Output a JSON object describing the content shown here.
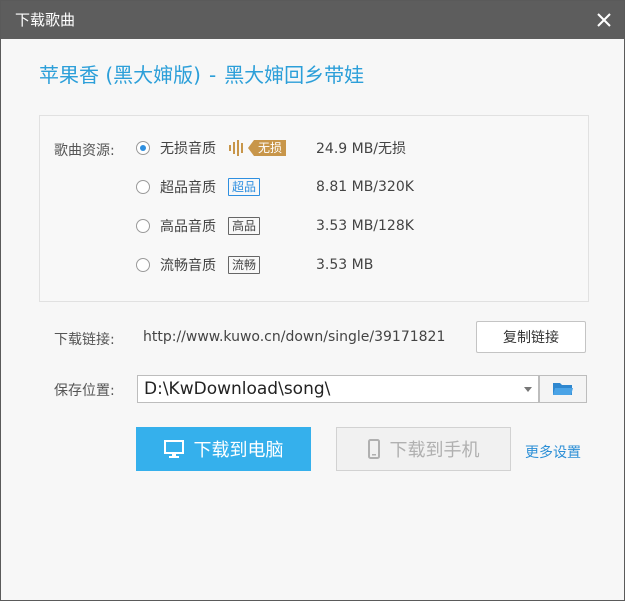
{
  "window": {
    "title": "下载歌曲"
  },
  "song": {
    "name": "苹果香 (黑大婶版)",
    "separator": "-",
    "artist": "黑大婶回乡带娃"
  },
  "source": {
    "label": "歌曲资源:",
    "options": [
      {
        "label": "无损音质",
        "badge": "无损",
        "size": "24.9 MB/无损",
        "selected": true
      },
      {
        "label": "超品音质",
        "badge": "超品",
        "size": "8.81 MB/320K",
        "selected": false
      },
      {
        "label": "高品音质",
        "badge": "高品",
        "size": "3.53 MB/128K",
        "selected": false
      },
      {
        "label": "流畅音质",
        "badge": "流畅",
        "size": "3.53 MB",
        "selected": false
      }
    ]
  },
  "link": {
    "label": "下载链接:",
    "url": "http://www.kuwo.cn/down/single/39171821",
    "copy_label": "复制链接"
  },
  "save": {
    "label": "保存位置:",
    "path": "D:\\KwDownload\\song\\"
  },
  "actions": {
    "pc_label": "下载到电脑",
    "phone_label": "下载到手机",
    "more_label": "更多设置"
  },
  "colors": {
    "titlebar": "#5d5d5d",
    "accent_blue": "#35b0ec",
    "title_blue": "#2c9fd9",
    "lossless_gold": "#c8964a"
  }
}
